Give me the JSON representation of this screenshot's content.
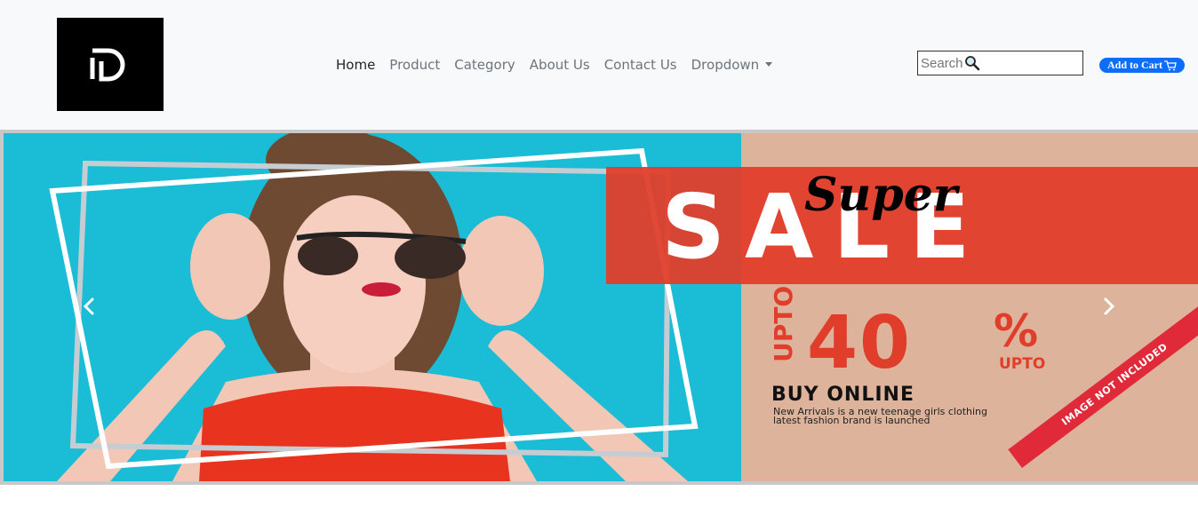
{
  "navbar": {
    "logo_icon": "d-monogram-logo",
    "links": [
      {
        "label": "Home",
        "active": true
      },
      {
        "label": "Product"
      },
      {
        "label": "Category"
      },
      {
        "label": "About Us"
      },
      {
        "label": "Contact Us"
      },
      {
        "label": "Dropdown"
      }
    ],
    "search": {
      "placeholder": "Search",
      "icon": "magnifier-icon"
    },
    "cart_button": {
      "label": "Add to Cart",
      "icon": "cart-icon"
    }
  },
  "carousel": {
    "slide": {
      "super": "Super",
      "sale": "SALE",
      "upto_vertical": "UPTO",
      "percent": "40",
      "percent_sign": "%",
      "upto": "UPTO",
      "buy_online": "BUY ONLINE",
      "description_line1": "New Arrivals is a new teenage girls clothing",
      "description_line2": "latest fashion brand is launched",
      "ribbon": "IMAGE NOT INCLUDED"
    },
    "prev_icon": "chevron-left-icon",
    "next_icon": "chevron-right-icon"
  },
  "colors": {
    "navbar_bg": "#f8f9fa",
    "accent_red": "#e03e2b",
    "cyan_bg": "#1bbcd6",
    "peach_bg": "#ddb49b",
    "button_blue": "#0d6efd"
  }
}
